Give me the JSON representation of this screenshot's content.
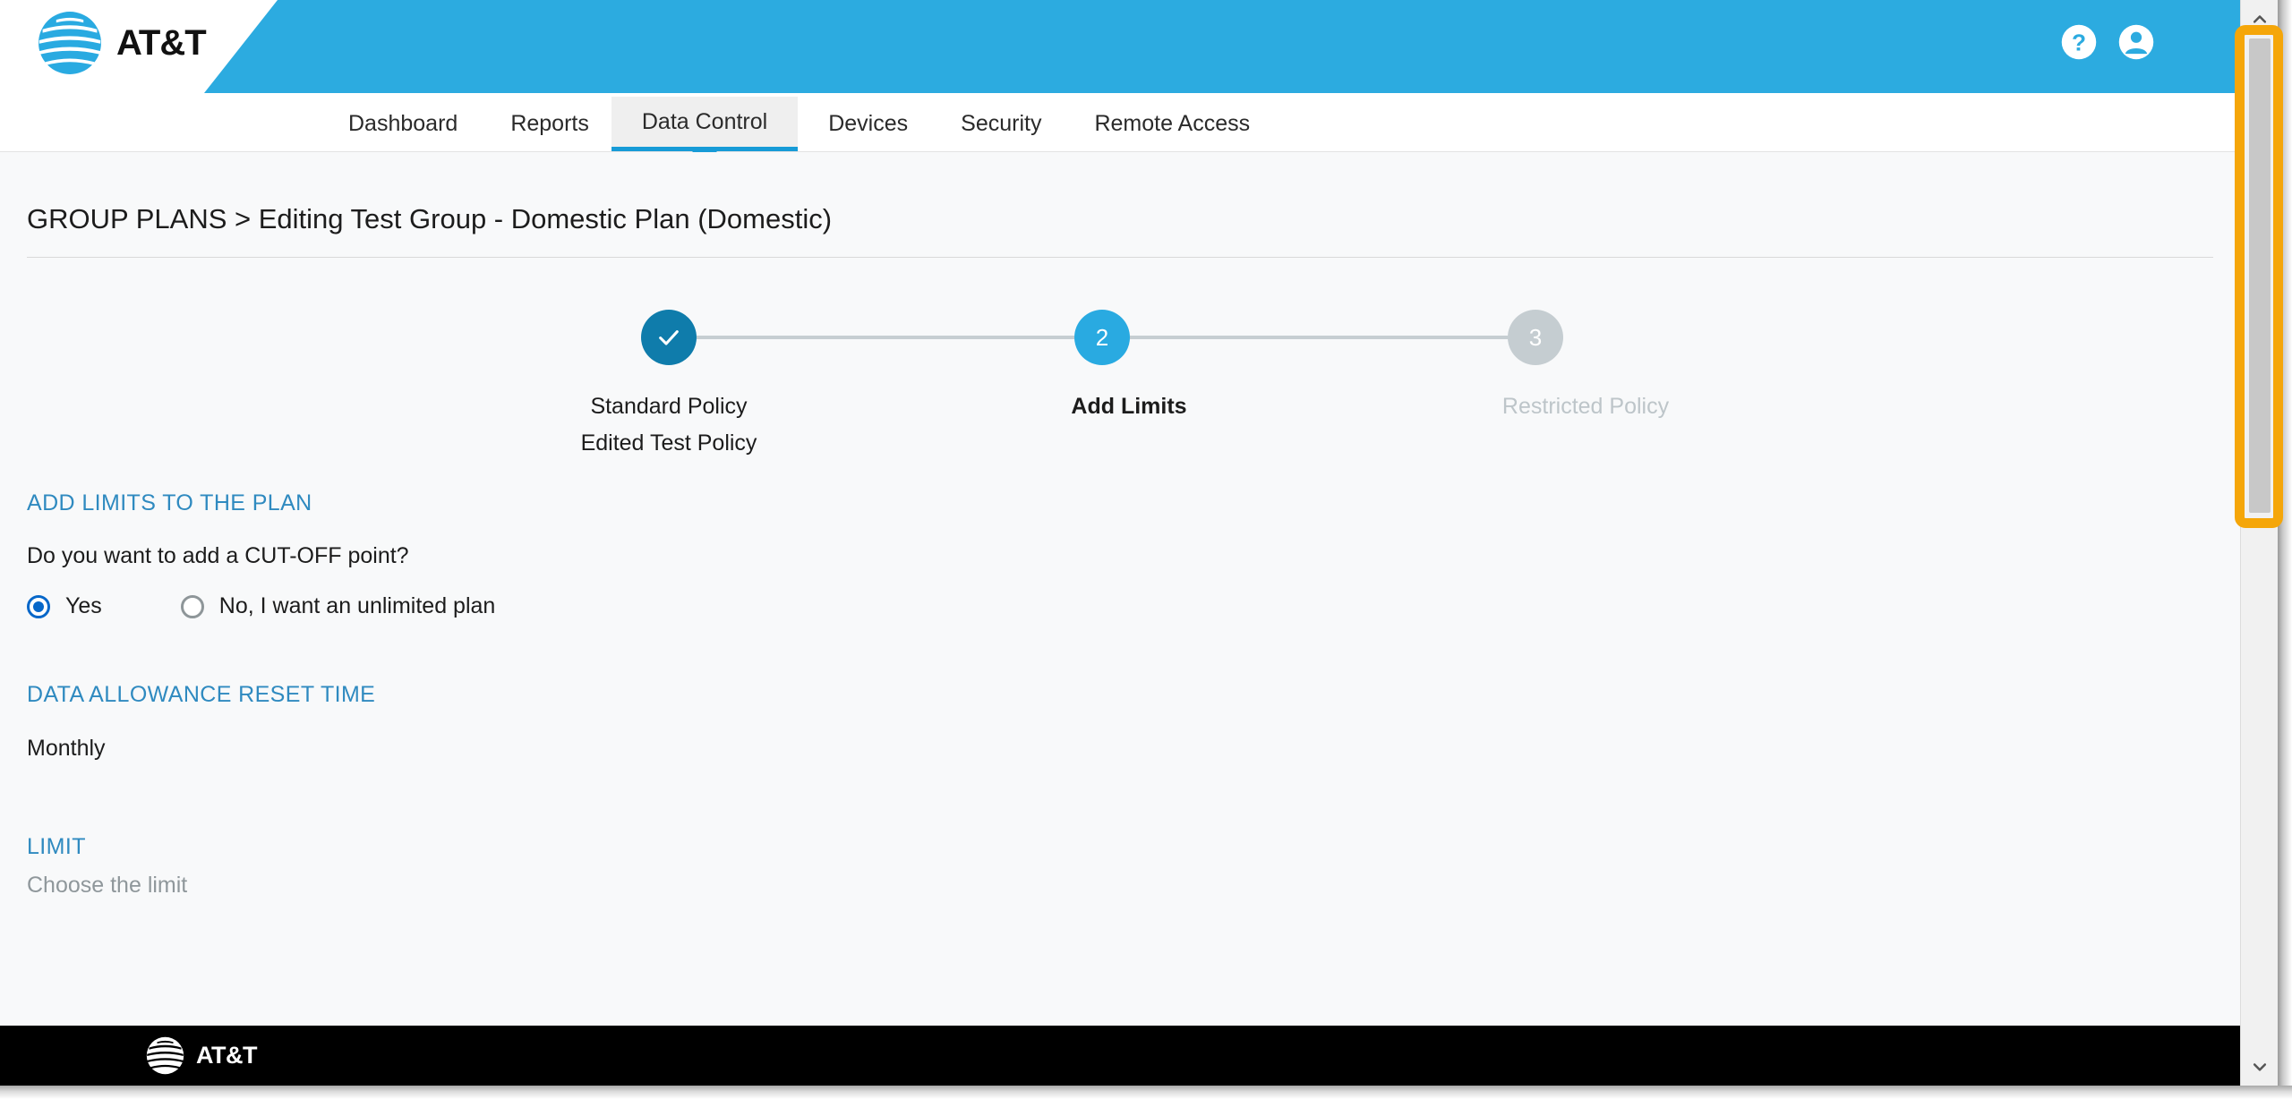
{
  "brand": {
    "name": "AT&T",
    "logo_icon": "att-globe-icon",
    "primary_blue": "#2cabe0",
    "accent_blue": "#179bd7",
    "link_blue": "#2f8ac0"
  },
  "header": {
    "help_icon": "help-circle-icon",
    "account_icon": "account-circle-icon"
  },
  "nav": {
    "items": [
      {
        "label": "Dashboard",
        "active": false
      },
      {
        "label": "Reports",
        "active": false
      },
      {
        "label": "Data Control",
        "active": true
      },
      {
        "label": "Devices",
        "active": false
      },
      {
        "label": "Security",
        "active": false
      },
      {
        "label": "Remote Access",
        "active": false
      }
    ]
  },
  "page": {
    "title": "GROUP PLANS > Editing Test Group - Domestic Plan (Domestic)"
  },
  "stepper": {
    "steps": [
      {
        "number": "1",
        "indicator": "✓",
        "state": "done",
        "label_line1": "Standard Policy",
        "label_line2": "Edited Test Policy"
      },
      {
        "number": "2",
        "indicator": "2",
        "state": "current",
        "label_line1": "Add Limits",
        "label_line2": ""
      },
      {
        "number": "3",
        "indicator": "3",
        "state": "todo",
        "label_line1": "Restricted Policy",
        "label_line2": ""
      }
    ]
  },
  "form": {
    "limits_section_title": "ADD LIMITS TO THE PLAN",
    "cutoff_question": "Do you want to add a CUT-OFF point?",
    "cutoff_options": [
      {
        "label": "Yes",
        "selected": true
      },
      {
        "label": "No, I want an unlimited plan",
        "selected": false
      }
    ],
    "reset_section_title": "DATA ALLOWANCE RESET TIME",
    "reset_value": "Monthly",
    "limit_section_title": "LIMIT",
    "limit_hint": "Choose the limit"
  },
  "footer": {
    "brand": "AT&T",
    "logo_icon": "att-globe-icon"
  },
  "scrollbar": {
    "up_arrow_icon": "chevron-up-icon",
    "down_arrow_icon": "chevron-down-icon",
    "highlight_color": "#f5a609"
  }
}
